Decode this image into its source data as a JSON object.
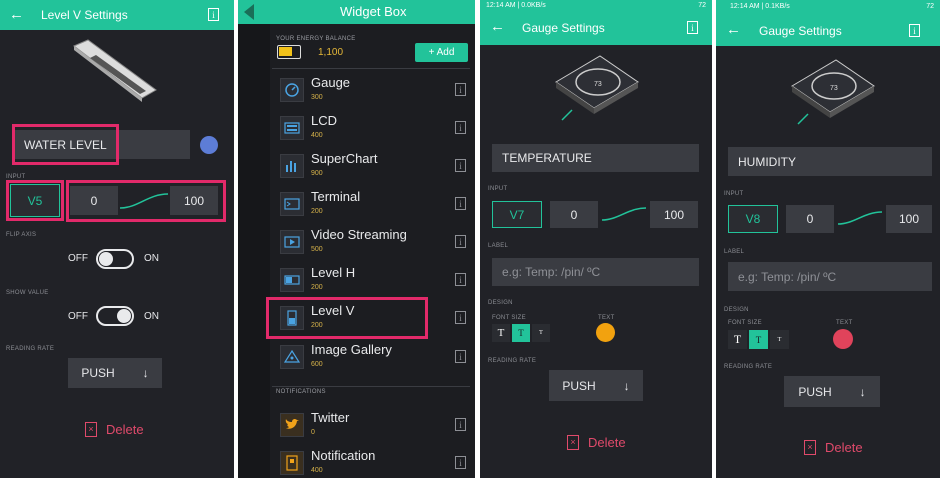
{
  "panel1": {
    "title": "Level V Settings",
    "name_value": "WATER LEVEL",
    "name_color": "#5d7dd6",
    "input_label": "INPUT",
    "pin": "V5",
    "min": "0",
    "max": "100",
    "flip_label": "FLIP AXIS",
    "flip_off": "OFF",
    "flip_on": "ON",
    "show_label": "SHOW VALUE",
    "show_off": "OFF",
    "show_on": "ON",
    "rate_label": "READING RATE",
    "push": "PUSH",
    "delete": "Delete"
  },
  "panel2": {
    "title": "Widget Box",
    "balance_label": "YOUR ENERGY BALANCE",
    "balance": "1,100",
    "add": "+ Add",
    "widgets": [
      {
        "name": "Gauge",
        "cost": "300"
      },
      {
        "name": "LCD",
        "cost": "400"
      },
      {
        "name": "SuperChart",
        "cost": "900"
      },
      {
        "name": "Terminal",
        "cost": "200"
      },
      {
        "name": "Video Streaming",
        "cost": "500"
      },
      {
        "name": "Level H",
        "cost": "200"
      },
      {
        "name": "Level V",
        "cost": "200"
      },
      {
        "name": "Image Gallery",
        "cost": "600"
      }
    ],
    "notifications_label": "NOTIFICATIONS",
    "notif_widgets": [
      {
        "name": "Twitter",
        "cost": "0"
      },
      {
        "name": "Notification",
        "cost": "400"
      }
    ]
  },
  "panel3": {
    "status_time": "12:14 AM | 0.0KB/s",
    "battery": "72",
    "title": "Gauge Settings",
    "gauge_value": "73",
    "name_value": "TEMPERATURE",
    "input_label": "INPUT",
    "pin": "V7",
    "min": "0",
    "max": "100",
    "label_label": "LABEL",
    "label_placeholder": "e.g: Temp: /pin/ ºC",
    "design_label": "DESIGN",
    "font_size_label": "FONT SIZE",
    "text_label": "TEXT",
    "text_color": "#f2a20f",
    "font_sizes": [
      "T",
      "T",
      "T"
    ],
    "rate_label": "READING RATE",
    "push": "PUSH",
    "delete": "Delete"
  },
  "panel4": {
    "status_time": "12:14 AM | 0.1KB/s",
    "battery": "72",
    "title": "Gauge Settings",
    "gauge_value": "73",
    "name_value": "HUMIDITY",
    "input_label": "INPUT",
    "pin": "V8",
    "min": "0",
    "max": "100",
    "label_label": "LABEL",
    "label_placeholder": "e.g: Temp: /pin/ ºC",
    "design_label": "DESIGN",
    "font_size_label": "FONT SIZE",
    "text_label": "TEXT",
    "text_color": "#e0435b",
    "font_sizes": [
      "T",
      "T",
      "T"
    ],
    "rate_label": "READING RATE",
    "push": "PUSH",
    "delete": "Delete"
  }
}
